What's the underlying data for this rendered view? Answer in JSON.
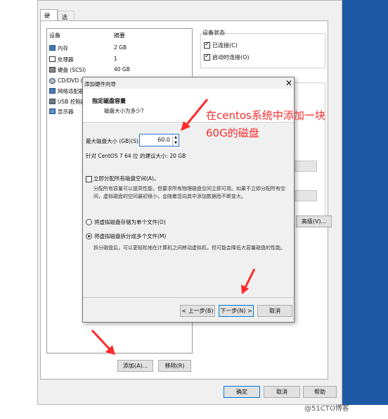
{
  "tabs": [
    "硬件",
    "选项"
  ],
  "device_list": {
    "headers": {
      "device": "设备",
      "summary": "摘要"
    },
    "rows": [
      {
        "icon": "memory-icon",
        "name": "内存",
        "summary": "2 GB"
      },
      {
        "icon": "cpu-icon",
        "name": "处理器",
        "summary": "1"
      },
      {
        "icon": "hard-disk-icon",
        "name": "硬盘 (SCSI)",
        "summary": "40 GB"
      },
      {
        "icon": "cd-dvd-icon",
        "name": "CD/DVD (I",
        "summary": ""
      },
      {
        "icon": "network-adapter-icon",
        "name": "网络适配器",
        "summary": ""
      },
      {
        "icon": "usb-controller-icon",
        "name": "USB 控制器",
        "summary": ""
      },
      {
        "icon": "display-icon",
        "name": "显示器",
        "summary": ""
      }
    ],
    "add_label": "添加(A)...",
    "remove_label": "移除(R)"
  },
  "device_status": {
    "title": "设备状态",
    "connected": "已连接(C)",
    "connect_on_start": "启动时连接(O)"
  },
  "advanced_label": "高级(V)...",
  "main_buttons": {
    "ok": "确定",
    "cancel": "取消",
    "help": "帮助"
  },
  "wizard": {
    "title": "添加硬件向导",
    "close": "✕",
    "header_title": "指定磁盘容量",
    "header_sub": "磁盘大小为多少?",
    "max_size_label": "最大磁盘大小 (GB)(S):",
    "max_size_value": "60.0",
    "recommended": "针对 CentOS 7 64 位 的建议大小: 20 GB",
    "allocate_label": "立即分配所有磁盘空间(A)。",
    "allocate_desc": "分配所有容量可以提高性能，但要求所有物理磁盘空间立即可用。如果不立即分配所有空间，虚拟磁盘的空间最初很小，会随着您向其中添加数据而不断变大。",
    "single_file": "将虚拟磁盘存储为单个文件(O)",
    "multi_file": "将虚拟磁盘拆分成多个文件(M)",
    "multi_desc": "拆分磁盘后，可以更轻松地在计算机之间移动虚拟机，但可能会降低大容量磁盘的性能。",
    "back": "< 上一步(B)",
    "next": "下一步(N) >",
    "cancel": "取消"
  },
  "annotation": "在centos系统中添加一块60G的磁盘",
  "watermark": "@51CTO博客",
  "colors": {
    "annotation": "#ff2a2a",
    "desktop": "#1d5aa3",
    "focus": "#0078d7"
  }
}
